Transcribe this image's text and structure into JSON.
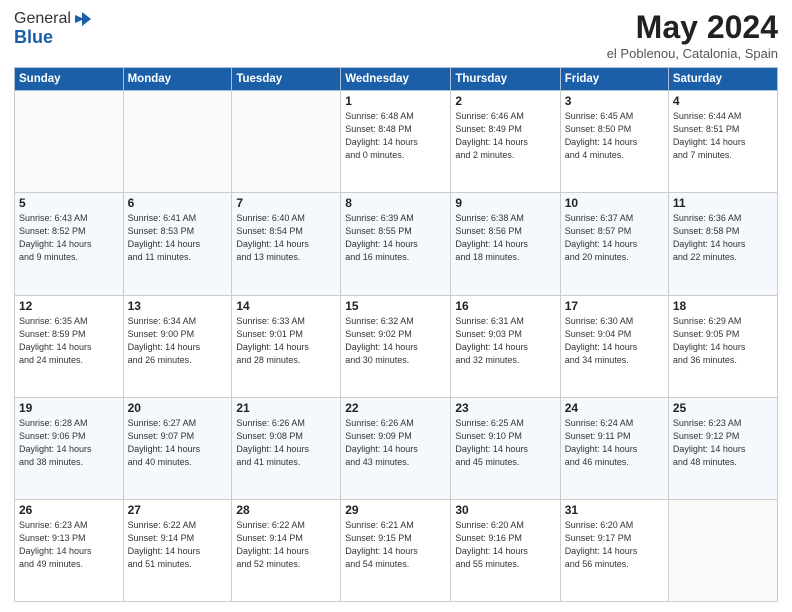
{
  "header": {
    "logo_general": "General",
    "logo_blue": "Blue",
    "month_title": "May 2024",
    "subtitle": "el Poblenou, Catalonia, Spain"
  },
  "weekdays": [
    "Sunday",
    "Monday",
    "Tuesday",
    "Wednesday",
    "Thursday",
    "Friday",
    "Saturday"
  ],
  "weeks": [
    [
      {
        "day": "",
        "info": ""
      },
      {
        "day": "",
        "info": ""
      },
      {
        "day": "",
        "info": ""
      },
      {
        "day": "1",
        "info": "Sunrise: 6:48 AM\nSunset: 8:48 PM\nDaylight: 14 hours\nand 0 minutes."
      },
      {
        "day": "2",
        "info": "Sunrise: 6:46 AM\nSunset: 8:49 PM\nDaylight: 14 hours\nand 2 minutes."
      },
      {
        "day": "3",
        "info": "Sunrise: 6:45 AM\nSunset: 8:50 PM\nDaylight: 14 hours\nand 4 minutes."
      },
      {
        "day": "4",
        "info": "Sunrise: 6:44 AM\nSunset: 8:51 PM\nDaylight: 14 hours\nand 7 minutes."
      }
    ],
    [
      {
        "day": "5",
        "info": "Sunrise: 6:43 AM\nSunset: 8:52 PM\nDaylight: 14 hours\nand 9 minutes."
      },
      {
        "day": "6",
        "info": "Sunrise: 6:41 AM\nSunset: 8:53 PM\nDaylight: 14 hours\nand 11 minutes."
      },
      {
        "day": "7",
        "info": "Sunrise: 6:40 AM\nSunset: 8:54 PM\nDaylight: 14 hours\nand 13 minutes."
      },
      {
        "day": "8",
        "info": "Sunrise: 6:39 AM\nSunset: 8:55 PM\nDaylight: 14 hours\nand 16 minutes."
      },
      {
        "day": "9",
        "info": "Sunrise: 6:38 AM\nSunset: 8:56 PM\nDaylight: 14 hours\nand 18 minutes."
      },
      {
        "day": "10",
        "info": "Sunrise: 6:37 AM\nSunset: 8:57 PM\nDaylight: 14 hours\nand 20 minutes."
      },
      {
        "day": "11",
        "info": "Sunrise: 6:36 AM\nSunset: 8:58 PM\nDaylight: 14 hours\nand 22 minutes."
      }
    ],
    [
      {
        "day": "12",
        "info": "Sunrise: 6:35 AM\nSunset: 8:59 PM\nDaylight: 14 hours\nand 24 minutes."
      },
      {
        "day": "13",
        "info": "Sunrise: 6:34 AM\nSunset: 9:00 PM\nDaylight: 14 hours\nand 26 minutes."
      },
      {
        "day": "14",
        "info": "Sunrise: 6:33 AM\nSunset: 9:01 PM\nDaylight: 14 hours\nand 28 minutes."
      },
      {
        "day": "15",
        "info": "Sunrise: 6:32 AM\nSunset: 9:02 PM\nDaylight: 14 hours\nand 30 minutes."
      },
      {
        "day": "16",
        "info": "Sunrise: 6:31 AM\nSunset: 9:03 PM\nDaylight: 14 hours\nand 32 minutes."
      },
      {
        "day": "17",
        "info": "Sunrise: 6:30 AM\nSunset: 9:04 PM\nDaylight: 14 hours\nand 34 minutes."
      },
      {
        "day": "18",
        "info": "Sunrise: 6:29 AM\nSunset: 9:05 PM\nDaylight: 14 hours\nand 36 minutes."
      }
    ],
    [
      {
        "day": "19",
        "info": "Sunrise: 6:28 AM\nSunset: 9:06 PM\nDaylight: 14 hours\nand 38 minutes."
      },
      {
        "day": "20",
        "info": "Sunrise: 6:27 AM\nSunset: 9:07 PM\nDaylight: 14 hours\nand 40 minutes."
      },
      {
        "day": "21",
        "info": "Sunrise: 6:26 AM\nSunset: 9:08 PM\nDaylight: 14 hours\nand 41 minutes."
      },
      {
        "day": "22",
        "info": "Sunrise: 6:26 AM\nSunset: 9:09 PM\nDaylight: 14 hours\nand 43 minutes."
      },
      {
        "day": "23",
        "info": "Sunrise: 6:25 AM\nSunset: 9:10 PM\nDaylight: 14 hours\nand 45 minutes."
      },
      {
        "day": "24",
        "info": "Sunrise: 6:24 AM\nSunset: 9:11 PM\nDaylight: 14 hours\nand 46 minutes."
      },
      {
        "day": "25",
        "info": "Sunrise: 6:23 AM\nSunset: 9:12 PM\nDaylight: 14 hours\nand 48 minutes."
      }
    ],
    [
      {
        "day": "26",
        "info": "Sunrise: 6:23 AM\nSunset: 9:13 PM\nDaylight: 14 hours\nand 49 minutes."
      },
      {
        "day": "27",
        "info": "Sunrise: 6:22 AM\nSunset: 9:14 PM\nDaylight: 14 hours\nand 51 minutes."
      },
      {
        "day": "28",
        "info": "Sunrise: 6:22 AM\nSunset: 9:14 PM\nDaylight: 14 hours\nand 52 minutes."
      },
      {
        "day": "29",
        "info": "Sunrise: 6:21 AM\nSunset: 9:15 PM\nDaylight: 14 hours\nand 54 minutes."
      },
      {
        "day": "30",
        "info": "Sunrise: 6:20 AM\nSunset: 9:16 PM\nDaylight: 14 hours\nand 55 minutes."
      },
      {
        "day": "31",
        "info": "Sunrise: 6:20 AM\nSunset: 9:17 PM\nDaylight: 14 hours\nand 56 minutes."
      },
      {
        "day": "",
        "info": ""
      }
    ]
  ]
}
